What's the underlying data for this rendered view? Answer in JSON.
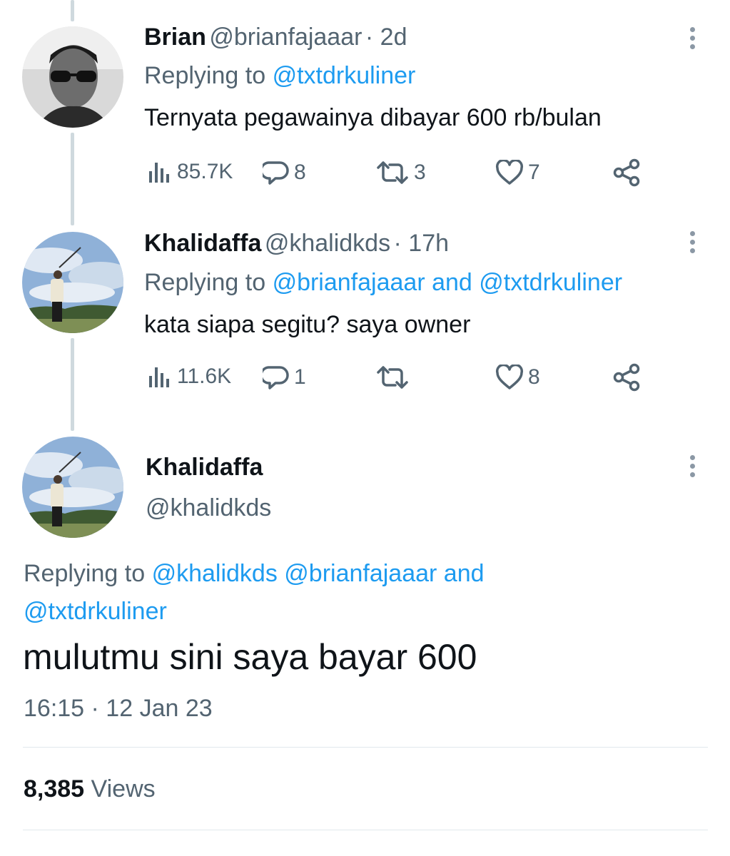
{
  "tweets": [
    {
      "name": "Brian",
      "handle": "@brianfajaaar",
      "time": "· 2d",
      "replying_prefix": "Replying to",
      "replying_to": "@txtdrkuliner",
      "text": "Ternyata pegawainya dibayar 600 rb/bulan",
      "stats": {
        "views": "85.7K",
        "replies": "8",
        "retweets": "3",
        "likes": "7"
      }
    },
    {
      "name": "Khalidaffa",
      "handle": "@khalidkds",
      "time": "· 17h",
      "replying_prefix": "Replying to",
      "replying_to": "@brianfajaaar and @txtdrkuliner",
      "text": "kata siapa segitu? saya owner",
      "stats": {
        "views": "11.6K",
        "replies": "1",
        "retweets": "",
        "likes": "8"
      }
    }
  ],
  "main": {
    "name": "Khalidaffa",
    "handle": "@khalidkds",
    "replying_prefix": "Replying to",
    "replying_line1": "@khalidkds @brianfajaaar and",
    "replying_line2": "@txtdrkuliner",
    "text": "mulutmu sini saya bayar 600",
    "timestamp": "16:15 · 12 Jan 23",
    "views_count": "8,385",
    "views_label": "Views"
  },
  "colors": {
    "link": "#1d9bf0",
    "muted": "#536471",
    "text": "#0f1419"
  },
  "icons": [
    "views-icon",
    "reply-icon",
    "retweet-icon",
    "like-icon",
    "share-icon",
    "more-icon"
  ]
}
